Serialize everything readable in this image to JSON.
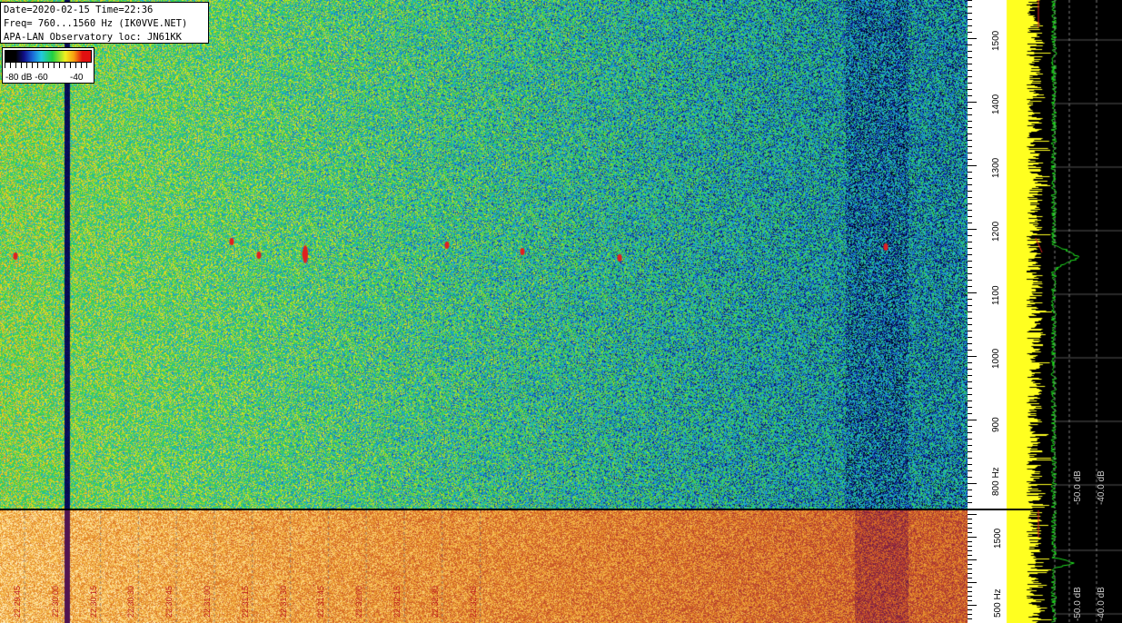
{
  "info": {
    "line1": "Date=2020-02-15 Time=22:36",
    "line2": "Freq= 760...1560 Hz (IK0VVE.NET)",
    "line3": "APA-LAN Observatory loc: JN61KK"
  },
  "legend": {
    "label_min": "-80 dB -60",
    "label_max": "-40"
  },
  "axis_top": {
    "ticks": [
      {
        "value": 1500,
        "label": "1500"
      },
      {
        "value": 1400,
        "label": "1400"
      },
      {
        "value": 1300,
        "label": "1300"
      },
      {
        "value": 1200,
        "label": "1200"
      },
      {
        "value": 1100,
        "label": "1100"
      },
      {
        "value": 1000,
        "label": "1000"
      },
      {
        "value": 900,
        "label": "900"
      },
      {
        "value": 800,
        "label": "800 Hz"
      }
    ],
    "fmin": 760,
    "fmax": 1560
  },
  "axis_bottom": {
    "ticks": [
      {
        "label": "1500"
      },
      {
        "label": "500 Hz"
      }
    ]
  },
  "spectrum_scale_top": {
    "labels": [
      "-50.0 dB",
      "-40.0 dB"
    ]
  },
  "spectrum_scale_bottom": {
    "labels": [
      "-50.0 dB",
      "-40.0 dB"
    ]
  },
  "time_labels": [
    "22:29:45",
    "22:30:00",
    "22:30:15",
    "22:30:30",
    "22:30:45",
    "22:31:00",
    "22:31:15",
    "22:31:30",
    "22:31:45",
    "22:32:00",
    "22:32:15",
    "22:32:30",
    "22:32:45"
  ],
  "colors": {
    "spectrum_yellow": "#ffff20",
    "spectrum_green": "#20e020",
    "spectrum_red": "#e02020",
    "gridline": "#808080"
  }
}
